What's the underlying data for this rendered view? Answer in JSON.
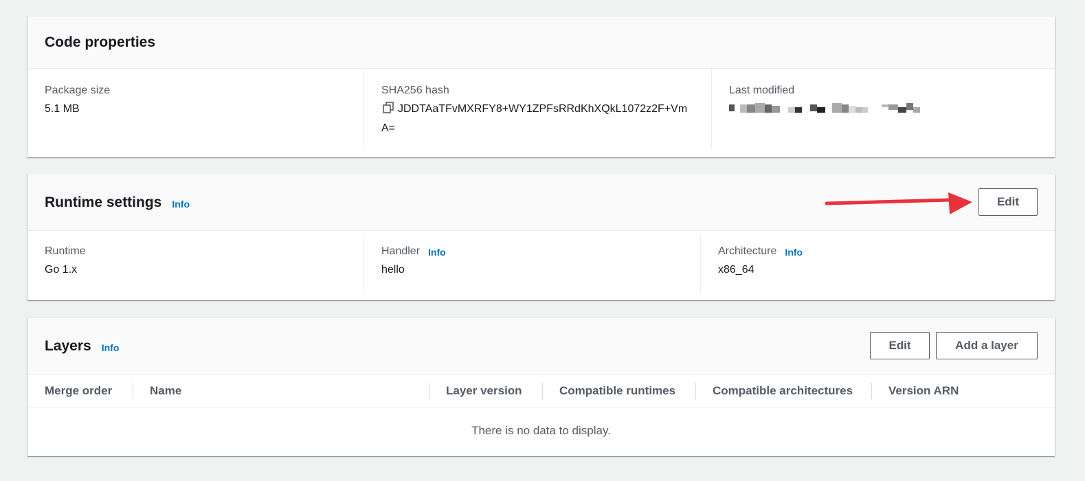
{
  "code_properties": {
    "title": "Code properties",
    "package_size_label": "Package size",
    "package_size_value": "5.1 MB",
    "sha_label": "SHA256 hash",
    "sha_value": "JDDTAaTFvMXRFY8+WY1ZPFsRRdKhXQkL1072z2F+VmA=",
    "last_modified_label": "Last modified"
  },
  "runtime_settings": {
    "title": "Runtime settings",
    "info": "Info",
    "edit_label": "Edit",
    "runtime_label": "Runtime",
    "runtime_value": "Go 1.x",
    "handler_label": "Handler",
    "handler_info": "Info",
    "handler_value": "hello",
    "architecture_label": "Architecture",
    "architecture_info": "Info",
    "architecture_value": "x86_64"
  },
  "layers": {
    "title": "Layers",
    "info": "Info",
    "edit_label": "Edit",
    "add_label": "Add a layer",
    "columns": [
      "Merge order",
      "Name",
      "Layer version",
      "Compatible runtimes",
      "Compatible architectures",
      "Version ARN"
    ],
    "empty_text": "There is no data to display."
  },
  "colors": {
    "link": "#0073bb",
    "annotation_arrow": "#e8323c"
  },
  "icons": {
    "copy": "copy-icon",
    "arrow": "red-arrow-annotation"
  }
}
